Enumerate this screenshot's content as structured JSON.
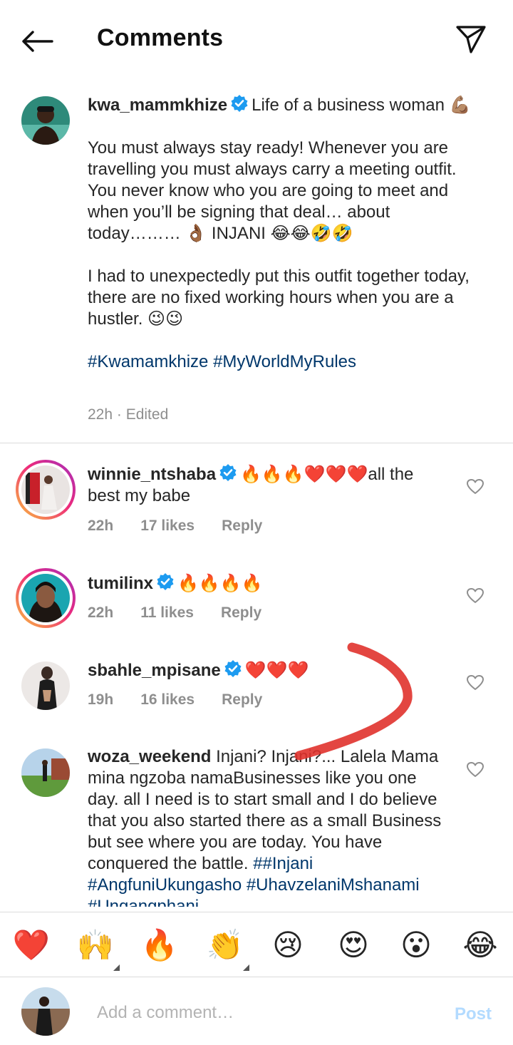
{
  "header": {
    "title": "Comments"
  },
  "post": {
    "username": "kwa_mammkhize",
    "lines": [
      "Life of a business woman 💪🏽",
      "You must always stay ready! Whenever you are travelling you must always carry a meeting outfit. You never know who you are going to meet and when you’ll be signing that deal… about today……… 👌🏾 INJANI 😂😂🤣🤣",
      "I had to unexpectedly put this outfit together today, there are no fixed working hours when you are a hustler. 😉😉"
    ],
    "hashtags": "#Kwamamkhize #MyWorldMyRules",
    "meta": "22h · Edited"
  },
  "comments": [
    {
      "username": "winnie_ntshaba",
      "text": "🔥🔥🔥❤️❤️❤️all the best my babe",
      "time": "22h",
      "likes": "17 likes",
      "reply": "Reply"
    },
    {
      "username": "tumilinx",
      "text": "🔥🔥🔥🔥",
      "time": "22h",
      "likes": "11 likes",
      "reply": "Reply"
    },
    {
      "username": "sbahle_mpisane",
      "text": "❤️❤️❤️",
      "time": "19h",
      "likes": "16 likes",
      "reply": "Reply"
    },
    {
      "username": "woza_weekend",
      "text": "Injani? Injani?... Lalela Mama mina ngzoba namaBusinesses like you one day. all I need is to start small and I do believe that you also started there as a small Business but see where you are today. You have conquered the battle.",
      "hashtags": "##Injani #AngfuniUkungasho #UhavzelaniMshanami #Ungangphani"
    }
  ],
  "emoji_bar": [
    "❤️",
    "🙌",
    "🔥",
    "👏",
    "😢",
    "😍",
    "😮",
    "😂"
  ],
  "composer": {
    "placeholder": "Add a comment…",
    "post_label": "Post"
  },
  "colors": {
    "text": "#262626",
    "muted": "#8e8e8e",
    "hashtag": "#00376b",
    "verified": "#1d9bf0",
    "post_disabled": "#b3dbff",
    "annotation": "#e0322c"
  }
}
